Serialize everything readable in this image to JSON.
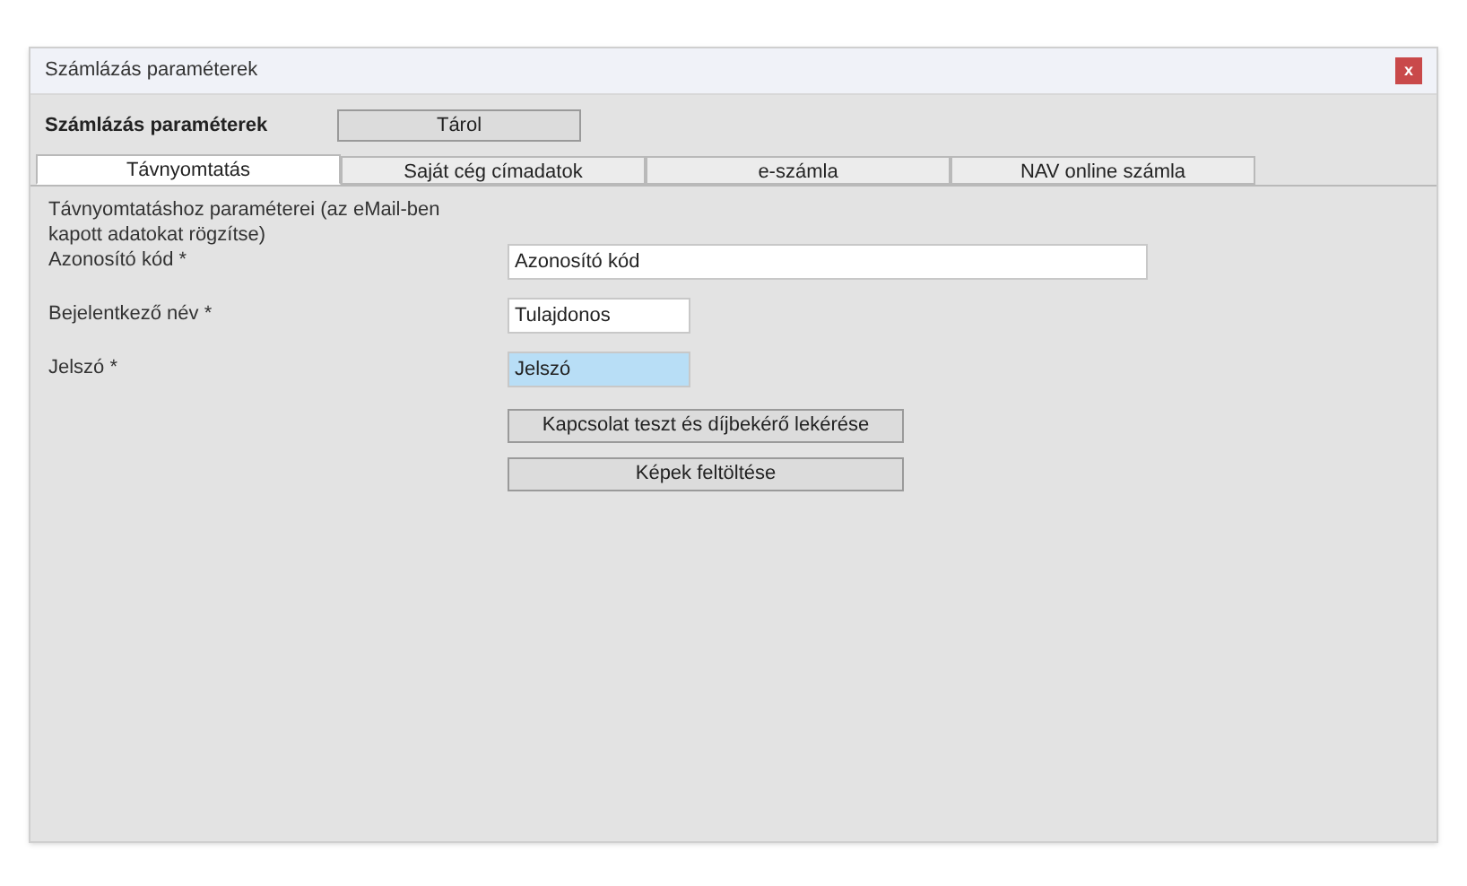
{
  "window": {
    "title": "Számlázás paraméterek",
    "close": "x"
  },
  "header": {
    "title": "Számlázás paraméterek",
    "save_button": "Tárol"
  },
  "tabs": [
    {
      "label": "Távnyomtatás",
      "selected": true
    },
    {
      "label": "Saját cég címadatok",
      "selected": false
    },
    {
      "label": "e-számla",
      "selected": false
    },
    {
      "label": "NAV online számla",
      "selected": false
    }
  ],
  "intro": "Távnyomtatáshoz paraméterei (az eMail-ben kapott adatokat rögzítse)",
  "fields": [
    {
      "label": "Azonosító kód *",
      "value": "Azonosító kód",
      "wide": true,
      "highlighted": false
    },
    {
      "label": "Bejelentkező név *",
      "value": "Tulajdonos",
      "wide": false,
      "highlighted": false
    },
    {
      "label": "Jelszó *",
      "value": "Jelszó",
      "wide": false,
      "highlighted": true
    }
  ],
  "buttons": [
    "Kapcsolat teszt és díjbekérő lekérése",
    "Képek feltöltése"
  ]
}
